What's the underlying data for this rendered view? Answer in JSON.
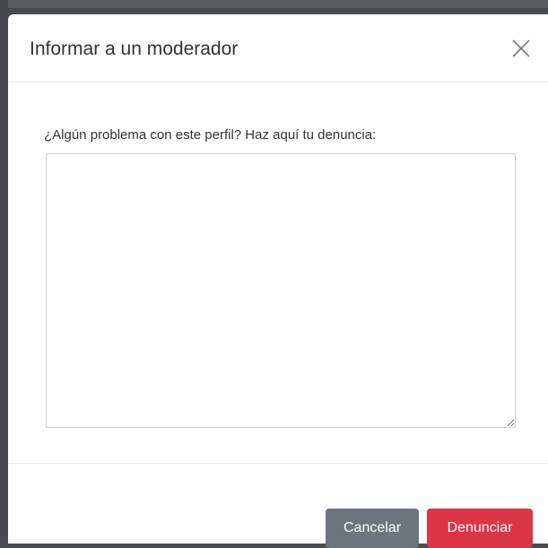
{
  "modal": {
    "title": "Informar a un moderador",
    "close_icon": "close-icon",
    "body": {
      "label": "¿Algún problema con este perfil? Haz aquí tu denuncia:",
      "textarea_value": ""
    },
    "footer": {
      "cancel_label": "Cancelar",
      "report_label": "Denunciar"
    }
  },
  "colors": {
    "cancel_button": "#6c757d",
    "report_button": "#dc3545",
    "backdrop": "#4a4c4f"
  }
}
